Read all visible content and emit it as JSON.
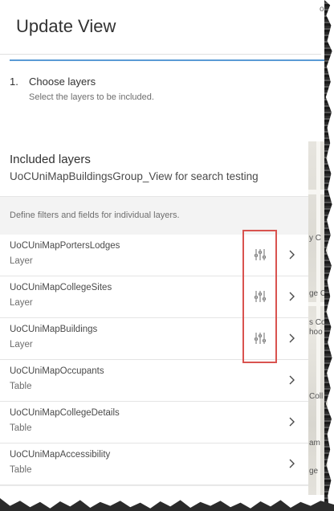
{
  "map": {
    "top_label": "ol",
    "labels": [
      "y C",
      "ge C",
      "s Co",
      "hoo",
      "Coll",
      "am",
      "ge"
    ]
  },
  "header": {
    "title": "Update View"
  },
  "step": {
    "number": "1.",
    "title": "Choose layers",
    "subtitle": "Select the layers to be included."
  },
  "included": {
    "title": "Included layers",
    "subtitle": "UoCUniMapBuildingsGroup_View for search testing"
  },
  "hint": "Define filters and fields for individual layers.",
  "layers": [
    {
      "name": "UoCUniMapPortersLodges",
      "type": "Layer",
      "has_filter": true
    },
    {
      "name": "UoCUniMapCollegeSites",
      "type": "Layer",
      "has_filter": true
    },
    {
      "name": "UoCUniMapBuildings",
      "type": "Layer",
      "has_filter": true
    },
    {
      "name": "UoCUniMapOccupants",
      "type": "Table",
      "has_filter": false
    },
    {
      "name": "UoCUniMapCollegeDetails",
      "type": "Table",
      "has_filter": false
    },
    {
      "name": "UoCUniMapAccessibility",
      "type": "Table",
      "has_filter": false
    }
  ],
  "icons": {
    "filter": "sliders-icon",
    "chevron": "chevron-right-icon"
  },
  "colors": {
    "step_accent": "#5a9bd5",
    "highlight": "#d9534f"
  }
}
